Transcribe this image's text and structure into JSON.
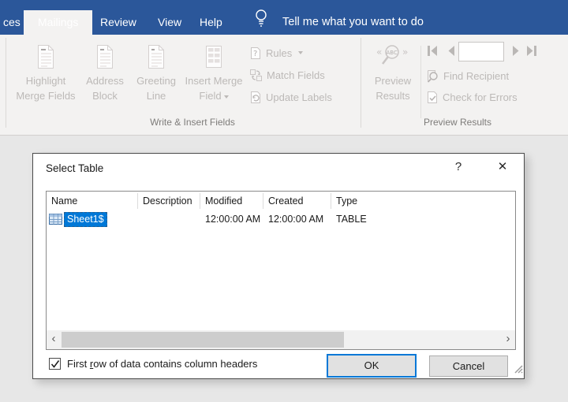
{
  "tab_bar": {
    "partial_tab": "ces",
    "active_tab": "Mailings",
    "tab_review": "Review",
    "tab_view": "View",
    "tab_help": "Help",
    "tell_me": "Tell me what you want to do"
  },
  "ribbon": {
    "buttons": {
      "highlight_line1": "Highlight",
      "highlight_line2": "Merge Fields",
      "address_line1": "Address",
      "address_line2": "Block",
      "greeting_line1": "Greeting",
      "greeting_line2": "Line",
      "insert_line1": "Insert Merge",
      "insert_line2": "Field",
      "rules": "Rules",
      "match_fields": "Match Fields",
      "update_labels": "Update Labels",
      "preview_line1": "Preview",
      "preview_line2": "Results",
      "find_recipient": "Find Recipient",
      "check_for_errors": "Check for Errors"
    },
    "record_value": "",
    "groups": {
      "write_insert": "Write & Insert Fields",
      "preview": "Preview Results"
    }
  },
  "dialog": {
    "title": "Select Table",
    "help_glyph": "?",
    "close_glyph": "✕",
    "columns": [
      "Name",
      "Description",
      "Modified",
      "Created",
      "Type"
    ],
    "row": {
      "name": "Sheet1$",
      "description": "",
      "modified": "12:00:00 AM",
      "created": "12:00:00 AM",
      "type": "TABLE"
    },
    "checkbox": {
      "checked": true,
      "label_pre": "First ",
      "label_accel": "r",
      "label_post": "ow of data contains column headers"
    },
    "ok_label": "OK",
    "cancel_label": "Cancel",
    "scrollbar": {
      "left_glyph": "‹",
      "right_glyph": "›"
    }
  },
  "colors": {
    "ribbon_blue": "#2b579a",
    "selection_blue": "#0078d7",
    "disabled_text": "#bcb9b7",
    "button_face": "#e1e1e1"
  }
}
